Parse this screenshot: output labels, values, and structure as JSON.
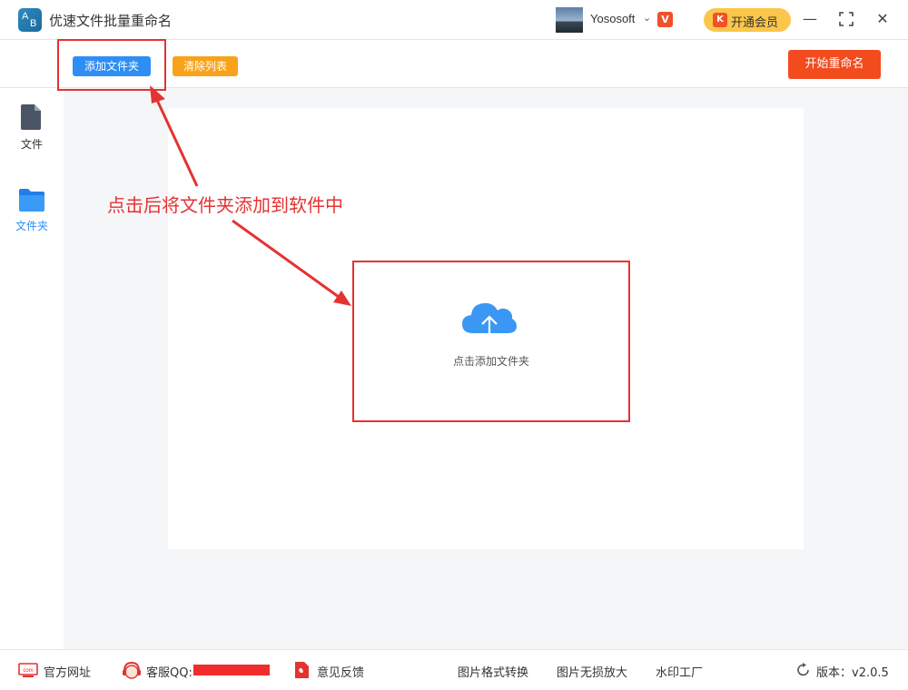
{
  "app": {
    "title": "优速文件批量重命名",
    "logo_letters": [
      "A",
      "B"
    ]
  },
  "user": {
    "name": "Yososoft",
    "vip_badge": "V",
    "vip_button_label": "开通会员"
  },
  "window_controls": {
    "minimize": "—",
    "maximize": "⛶",
    "close": "✕"
  },
  "toolbar": {
    "add_folder_label": "添加文件夹",
    "clear_list_label": "清除列表",
    "start_rename_label": "开始重命名"
  },
  "sidebar": {
    "items": [
      {
        "label": "文件",
        "icon": "file-icon",
        "active": false
      },
      {
        "label": "文件夹",
        "icon": "folder-icon",
        "active": true
      }
    ]
  },
  "main": {
    "drop_zone_label": "点击添加文件夹",
    "annotation_text": "点击后将文件夹添加到软件中"
  },
  "footer": {
    "website_label": "官方网址",
    "service_qq_label": "客服QQ:",
    "feedback_label": "意见反馈",
    "links": [
      "图片格式转换",
      "图片无损放大",
      "水印工厂"
    ],
    "version_label": "版本：v2.0.5"
  },
  "colors": {
    "accent_blue": "#2f8ef4",
    "clear_orange": "#f8a21b",
    "start_red": "#f24b1e",
    "vip_yellow": "#fbc64a",
    "annotation_red": "#e53232"
  }
}
